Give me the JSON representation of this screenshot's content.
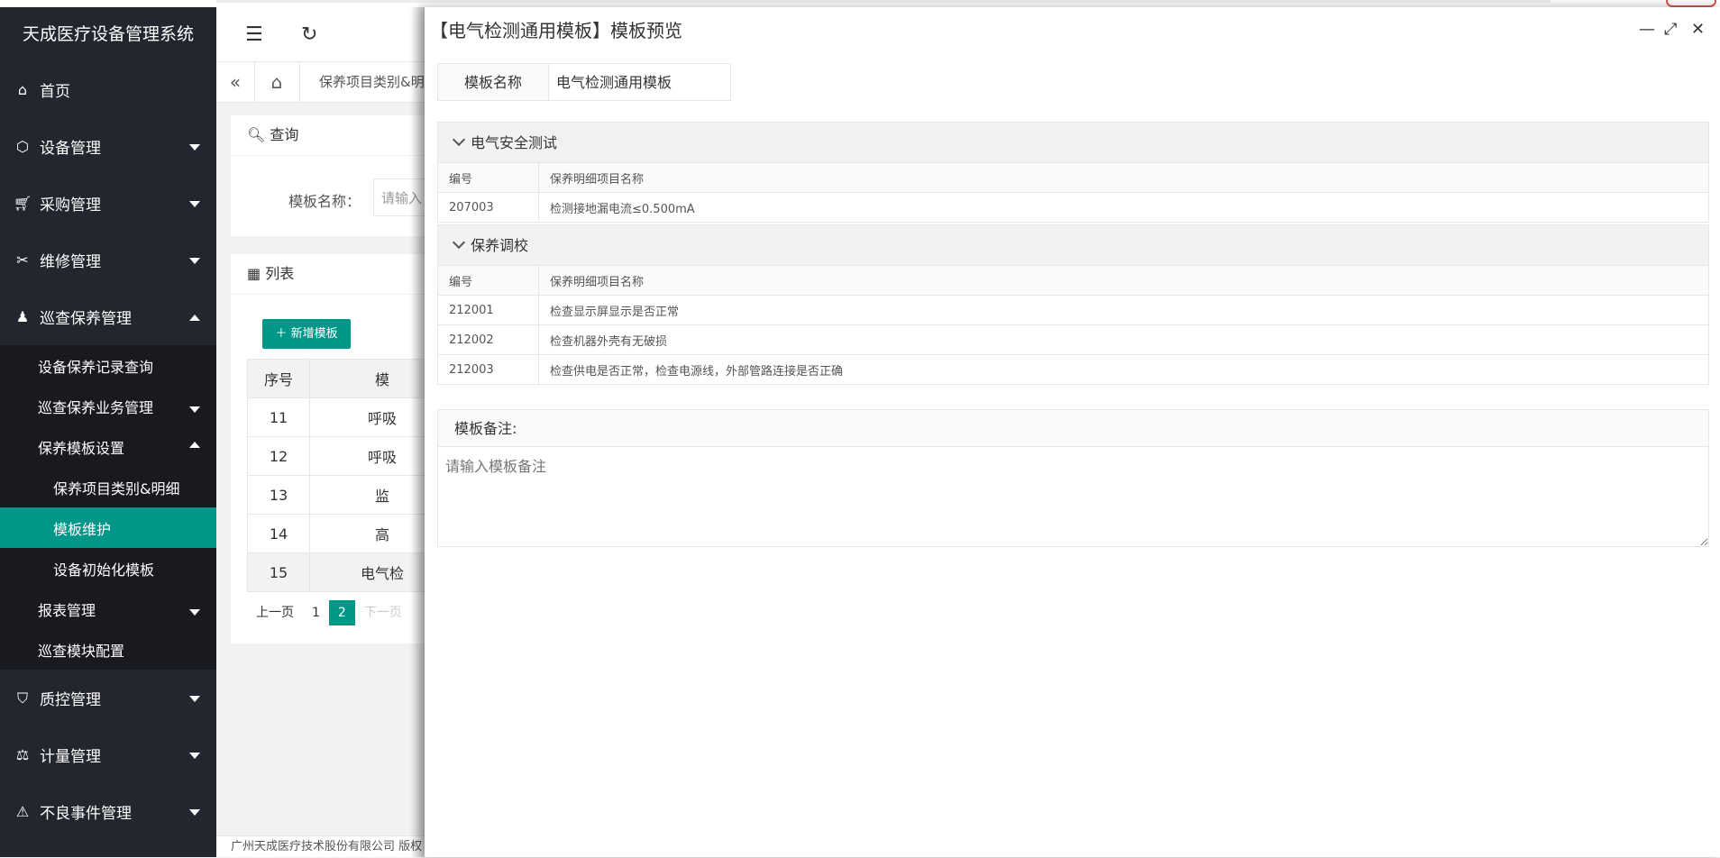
{
  "app": {
    "title": "天成医疗设备管理系统"
  },
  "sidebar": {
    "items": [
      {
        "label": "首页"
      },
      {
        "label": "设备管理"
      },
      {
        "label": "采购管理"
      },
      {
        "label": "维修管理"
      },
      {
        "label": "巡查保养管理"
      }
    ],
    "sub": [
      {
        "label": "设备保养记录查询"
      },
      {
        "label": "巡查保养业务管理"
      },
      {
        "label": "保养模板设置"
      },
      {
        "label": "保养项目类别&明细"
      },
      {
        "label": "模板维护"
      },
      {
        "label": "设备初始化模板"
      },
      {
        "label": "报表管理"
      },
      {
        "label": "巡查模块配置"
      }
    ],
    "bottom": [
      {
        "label": "质控管理"
      },
      {
        "label": "计量管理"
      },
      {
        "label": "不良事件管理"
      }
    ]
  },
  "tabs": {
    "current": "保养项目类别&明"
  },
  "query": {
    "title": "查询",
    "label": "模板名称：",
    "placeholder": "请输入"
  },
  "list": {
    "title": "列表",
    "add_label": "新增模板",
    "headers": [
      "序号",
      "模"
    ],
    "rows": [
      {
        "no": "11",
        "name": "呼吸"
      },
      {
        "no": "12",
        "name": "呼吸"
      },
      {
        "no": "13",
        "name": "监"
      },
      {
        "no": "14",
        "name": "高"
      },
      {
        "no": "15",
        "name": "电气检"
      }
    ],
    "pager": {
      "prev": "上一页",
      "p1": "1",
      "p2": "2",
      "next": "下一页"
    }
  },
  "footer": {
    "text": "广州天成医疗技术股份有限公司 版权"
  },
  "modal": {
    "title": "【电气检测通用模板】模板预览",
    "name_label": "模板名称",
    "name_value": "电气检测通用模板",
    "sections": [
      {
        "title": "电气安全测试",
        "col1": "编号",
        "col2": "保养明细项目名称",
        "rows": [
          {
            "code": "207003",
            "name": "检测接地漏电流≤0.500mA"
          }
        ]
      },
      {
        "title": "保养调校",
        "col1": "编号",
        "col2": "保养明细项目名称",
        "rows": [
          {
            "code": "212001",
            "name": "检查显示屏显示是否正常"
          },
          {
            "code": "212002",
            "name": "检查机器外壳有无破损"
          },
          {
            "code": "212003",
            "name": "检查供电是否正常，检查电源线，外部管路连接是否正确"
          }
        ]
      }
    ],
    "remark_label": "模板备注:",
    "remark_placeholder": "请输入模板备注"
  }
}
